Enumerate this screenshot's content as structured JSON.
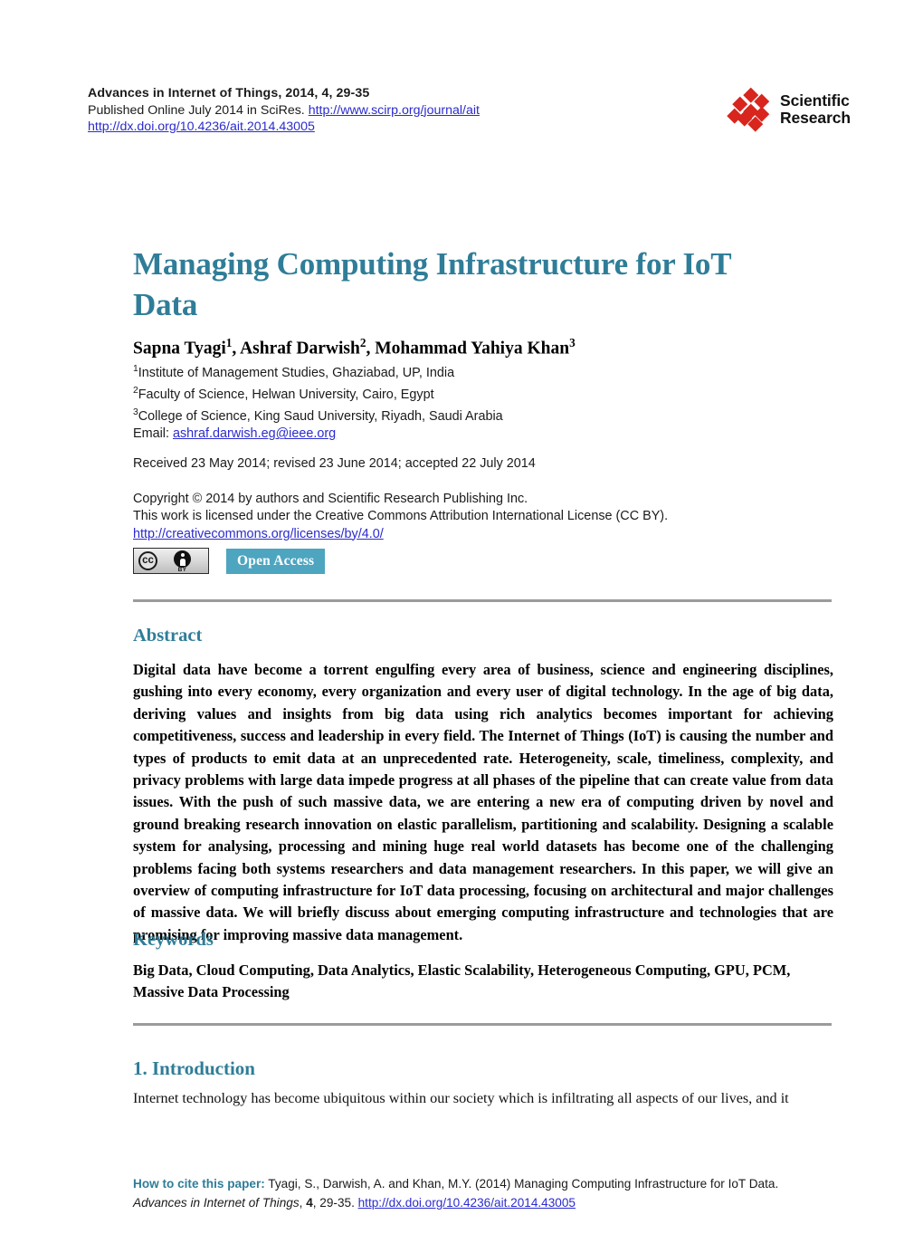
{
  "masthead": {
    "journal_line": "Advances in Internet of Things, 2014, 4, 29-35",
    "published_prefix": "Published Online July 2014 in SciRes. ",
    "journal_url": "http://www.scirp.org/journal/ait",
    "doi_url": "http://dx.doi.org/10.4236/ait.2014.43005"
  },
  "publisher_logo": {
    "icon": "scientific-research-diamond-logo",
    "line1": "Scientific",
    "line2": "Research",
    "color": "#d8251d"
  },
  "article": {
    "title": "Managing Computing Infrastructure for IoT Data",
    "authors": "Sapna Tyagi1, Ashraf Darwish2, Mohammad Yahiya Khan3",
    "affiliations": [
      {
        "marker": "1",
        "text": "Institute of Management Studies, Ghaziabad, UP, India"
      },
      {
        "marker": "2",
        "text": "Faculty of Science, Helwan University, Cairo, Egypt"
      },
      {
        "marker": "3",
        "text": "College of Science, King Saud University, Riyadh, Saudi Arabia"
      }
    ],
    "email_label": "Email: ",
    "email": "ashraf.darwish.eg@ieee.org",
    "dates": "Received 23 May 2014; revised 23 June 2014; accepted 22 July 2014"
  },
  "copyright": {
    "line1": "Copyright © 2014 by authors and Scientific Research Publishing Inc.",
    "line2": "This work is licensed under the Creative Commons Attribution International License (CC BY).",
    "license_url": "http://creativecommons.org/licenses/by/4.0/"
  },
  "badges": {
    "cc_mark": "cc",
    "cc_by_label": "BY",
    "open_access": "Open Access",
    "open_access_color": "#4da5c0"
  },
  "sections": {
    "abstract_heading": "Abstract",
    "abstract_body": "Digital data have become a torrent engulfing every area of business, science and engineering disciplines, gushing into every economy, every organization and every user of digital technology. In the age of big data, deriving values and insights from big data using rich analytics becomes important for achieving competitiveness, success and leadership in every field. The Internet of Things (IoT) is causing the number and types of products to emit data at an unprecedented rate. Heterogeneity, scale, timeliness, complexity, and privacy problems with large data impede progress at all phases of the pipeline that can create value from data issues. With the push of such massive data, we are entering a new era of computing driven by novel and ground breaking research innovation on elastic parallelism, partitioning and scalability. Designing a scalable system for analysing, processing and mining huge real world datasets has become one of the challenging problems facing both systems researchers and data management researchers. In this paper, we will give an overview of computing infrastructure for IoT data processing, focusing on architectural and major challenges of massive data. We will briefly discuss about emerging computing infrastructure and technologies that are promising for improving massive data management.",
    "keywords_heading": "Keywords",
    "keywords_body": "Big Data, Cloud Computing, Data Analytics, Elastic Scalability, Heterogeneous Computing, GPU, PCM, Massive Data Processing",
    "intro_heading": "1. Introduction",
    "intro_body": "Internet technology has become ubiquitous within our society which is infiltrating all aspects of our lives, and it"
  },
  "footer": {
    "cite_lead": "How to cite this paper:",
    "cite_text_1": " Tyagi, S., Darwish, A. and Khan, M.Y. (2014) Managing Computing Infrastructure for IoT Data. ",
    "cite_italic_1": "Advances in Internet of Things",
    "cite_text_2": ", ",
    "cite_bold_volume": "4",
    "cite_text_3": ", 29-35. ",
    "cite_url": "http://dx.doi.org/10.4236/ait.2014.43005"
  },
  "theme": {
    "heading_color": "#2f7d98",
    "rule_color": "#9b9b9b",
    "link_color": "#2b2bcf"
  }
}
